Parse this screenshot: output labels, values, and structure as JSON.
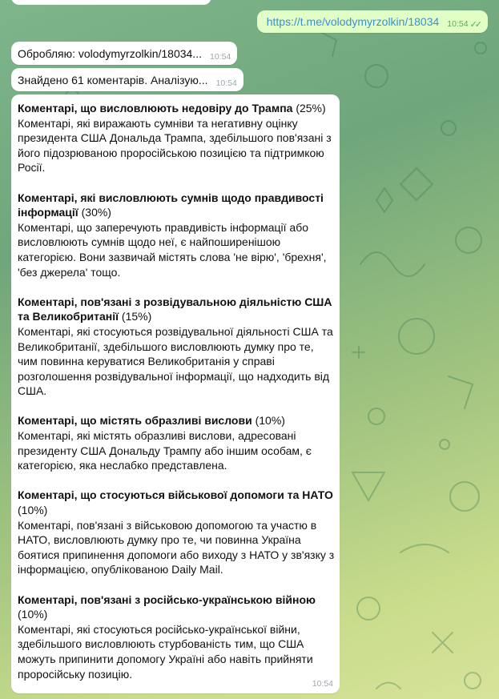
{
  "outgoing": {
    "link": "https://t.me/volodymyrzolkin/18034",
    "time": "10:54"
  },
  "incoming_status": [
    {
      "text": "Обробляю: volodymyrzolkin/18034...",
      "time": "10:54"
    },
    {
      "text": "Знайдено 61 коментарів. Аналізую...",
      "time": "10:54"
    }
  ],
  "analysis": {
    "time": "10:54",
    "sections": [
      {
        "title": "Коментарі, що висловлюють недовіру до Трампа",
        "pct": " (25%)",
        "body": "Коментарі, які виражають сумніви та негативну оцінку президента США Дональда Трампа, здебільшого пов'язані з його підозрюваною проросійською позицією та підтримкою Росії."
      },
      {
        "title": "Коментарі, які висловлюють сумнів щодо правдивості інформації",
        "pct": " (30%)",
        "body": "Коментарі, що заперечують правдивість інформації або висловлюють сумнів щодо неї, є найпоширенішою категорією. Вони зазвичай містять слова 'не вірю', 'брехня', 'без джерела' тощо."
      },
      {
        "title": "Коментарі, пов'язані з розвідувальною діяльністю США та Великобританії",
        "pct": " (15%)",
        "body": "Коментарі, які стосуються розвідувальної діяльності США та Великобританії, здебільшого висловлюють думку про те, чим повинна керуватися Великобританія у справі розголошення розвідувальної інформації, що надходить від США."
      },
      {
        "title": "Коментарі, що містять образливі вислови",
        "pct": " (10%)",
        "body": "Коментарі, які містять образливі вислови, адресовані президенту США Дональду Трампу або іншим особам, є категорією, яка неслабко представлена."
      },
      {
        "title": "Коментарі, що стосуються військової допомоги та НАТО",
        "pct": " (10%)",
        "body": "Коментарі, пов'язані з військовою допомогою та участю в НАТО, висловлюють думку про те, чи повинна Україна боятися припинення допомоги або виходу з НАТО у зв'язку з інформацією, опублікованою Daily Mail."
      },
      {
        "title": "Коментарі, пов'язані з російсько-українською війною",
        "pct": " (10%)",
        "body": "Коментарі, які стосуються російсько-української війни, здебільшого висловлюють стурбованість тим, що США можуть припинити допомогу Україні або навіть прийняти проросійську позицію."
      }
    ]
  }
}
